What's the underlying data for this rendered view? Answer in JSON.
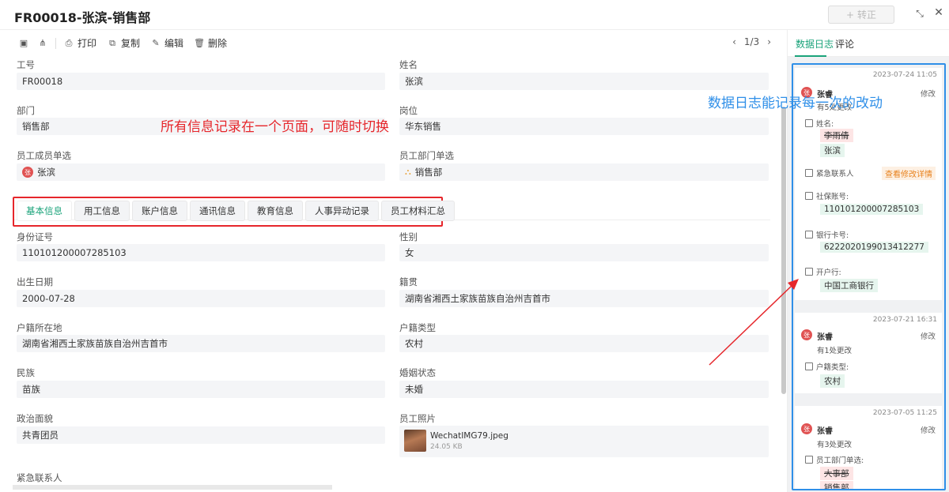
{
  "header": {
    "title": "FR00018-张滨-销售部",
    "convert_label": "转正",
    "convert_icon": "+"
  },
  "toolbar": {
    "print_label": "打印",
    "copy_label": "复制",
    "edit_label": "编辑",
    "delete_label": "删除",
    "pager_text": "1/3"
  },
  "fields": {
    "employee_no_label": "工号",
    "employee_no": "FR00018",
    "name_label": "姓名",
    "name": "张滨",
    "dept_label": "部门",
    "dept": "销售部",
    "position_label": "岗位",
    "position": "华东销售",
    "member_label": "员工成员单选",
    "member": "张滨",
    "member_avatar": "张",
    "dept_single_label": "员工部门单选",
    "dept_single": "销售部",
    "id_label": "身份证号",
    "id": "110101200007285103",
    "gender_label": "性别",
    "gender": "女",
    "birth_label": "出生日期",
    "birth": "2000-07-28",
    "native_label": "籍贯",
    "native": "湖南省湘西土家族苗族自治州吉首市",
    "household_label": "户籍所在地",
    "household": "湖南省湘西土家族苗族自治州吉首市",
    "household_type_label": "户籍类型",
    "household_type": "农村",
    "ethnic_label": "民族",
    "ethnic": "苗族",
    "marital_label": "婚姻状态",
    "marital": "未婚",
    "political_label": "政治面貌",
    "political": "共青团员",
    "photo_label": "员工照片",
    "photo_name": "WechatIMG79.jpeg",
    "photo_size": "24.05 KB",
    "emergency_label": "紧急联系人"
  },
  "tabs": [
    "基本信息",
    "用工信息",
    "账户信息",
    "通讯信息",
    "教育信息",
    "人事异动记录",
    "员工材料汇总"
  ],
  "annotations": {
    "red": "所有信息记录在一个页面，可随时切换",
    "blue": "数据日志能记录每一次的改动"
  },
  "side": {
    "tab_log": "数据日志",
    "tab_comment": "评论",
    "logs": [
      {
        "time": "2023-07-24 11:05",
        "user": "张睿",
        "avatar": "张",
        "action": "修改",
        "count": "有5处更改",
        "f1_label": "姓名:",
        "f1_old": "李雨倩",
        "f1_new": "张滨",
        "f2_label": "紧急联系人",
        "f2_link": "查看修改详情",
        "f3_label": "社保账号:",
        "f3_new": "110101200007285103",
        "f4_label": "银行卡号:",
        "f4_new": "6222020199013412277",
        "f5_label": "开户行:",
        "f5_new": "中国工商银行"
      },
      {
        "time": "2023-07-21 16:31",
        "user": "张睿",
        "avatar": "张",
        "action": "修改",
        "count": "有1处更改",
        "f1_label": "户籍类型:",
        "f1_new": "农村"
      },
      {
        "time": "2023-07-05 11:25",
        "user": "张睿",
        "avatar": "张",
        "action": "修改",
        "count": "有3处更改",
        "f1_label": "员工部门单选:",
        "f1_old": "大事部",
        "f1_new": "销售部"
      }
    ]
  },
  "colors": {
    "accent": "#1aa37a",
    "annotation_red": "#e6262b",
    "annotation_blue": "#2f8fe8"
  }
}
